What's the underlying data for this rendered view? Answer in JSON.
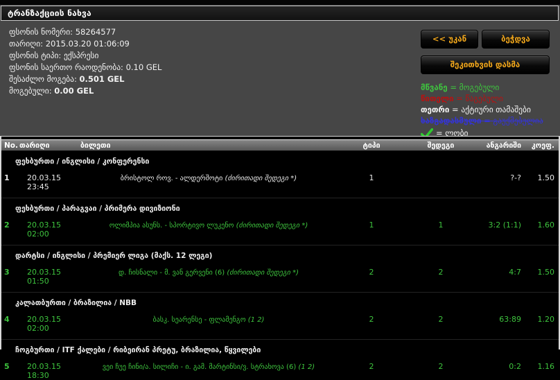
{
  "title": "ტრანზაქციის ნახვა",
  "info": {
    "bet_number": {
      "label": "ფსონის ნომერი:",
      "value": "58264577"
    },
    "date": {
      "label": "თარიღი:",
      "value": "2015.03.20 01:06:09"
    },
    "bet_type": {
      "label": "ფსონის ტიპი:",
      "value": "ექსპრესი"
    },
    "total_amount": {
      "label": "ფსონის საერთო რაოდენობა:",
      "value": "0.10 GEL"
    },
    "possible_win": {
      "label": "შესაძლო მოგება:",
      "value": "0.501 GEL"
    },
    "won": {
      "label": "მოგებული:",
      "value": "0.00 GEL"
    }
  },
  "buttons": {
    "back": "<< უკან",
    "print": "ბეჭდვა",
    "ask": "შეკითხვის დასმა"
  },
  "legend": {
    "won": {
      "key": "მწვანე",
      "rest": "= მოგებული"
    },
    "lost": {
      "key": "წითელი",
      "rest": "= წაგებული"
    },
    "active": {
      "key": "თეთრი",
      "rest": "= აქტიური თამაშები"
    },
    "cancelled": {
      "key": "ხაზგადასმული",
      "rest": "= გაუქმებულია"
    },
    "lobby": {
      "icon": "check-icon",
      "rest": "= ლობი"
    }
  },
  "colors": {
    "won_green": "#3ec43e",
    "lost_red": "#b91111",
    "active_white": "#eaeaea",
    "cancelled_blue": "#3434d6",
    "button_orange": "#f2a71b"
  },
  "table": {
    "headers": {
      "no": "No.",
      "date": "თარიღი",
      "ticket": "ბილეთი",
      "type": "ტიპი",
      "result": "შედეგი",
      "score": "ანგარიში",
      "coef": "კოეფ."
    },
    "groups": [
      {
        "league": "ფეხბურთი / ინგლისი / კონფერენსი",
        "row": {
          "no": "1",
          "date": "20.03.15 23:45",
          "match": "ბრისტოლ როვ. - ალდერშოტი",
          "note": "(ძირითადი შედეგი *)",
          "type": "1",
          "result": "",
          "score": "?-?",
          "coef": "1.50",
          "status": "active"
        }
      },
      {
        "league": "ფეხბურთი / პარაგვაი / პრიმერა დივიზიონი",
        "row": {
          "no": "2",
          "date": "20.03.15 02:00",
          "match": "ოლიმპია ასუნს. - სპორტივო ლუკენო",
          "note": "(ძირითადი შედეგი *)",
          "type": "1",
          "result": "1",
          "score": "3:2 (1:1)",
          "coef": "1.60",
          "status": "won"
        }
      },
      {
        "league": "დარტსი / ინგლისი / პრემიერ ლიგა (მაქს. 12 ლეგი)",
        "row": {
          "no": "3",
          "date": "20.03.15 01:50",
          "match": "დ. ჩისნალი - მ. ვან გერვენი (6)",
          "note": "(ძირითადი შედეგი *)",
          "type": "2",
          "result": "2",
          "score": "4:7",
          "coef": "1.50",
          "status": "won"
        }
      },
      {
        "league": "კალათბურთი / ბრაზილია / NBB",
        "row": {
          "no": "4",
          "date": "20.03.15 02:00",
          "match": "ბასკ. სეარენსე - ფლამენგო",
          "note": "(1 2)",
          "type": "2",
          "result": "2",
          "score": "63:89",
          "coef": "1.20",
          "status": "won"
        }
      },
      {
        "league": "ჩოგბურთი / ITF ქალები / რიბეირან პრეტუ, ბრაზილია, წყვილები",
        "row": {
          "no": "5",
          "date": "20.03.15 18:30",
          "match": "ვეი ჩუე ჩინი/ა. სილიჩი - ი. გამ. მარტინსი/ვ. სტრახოვა (6)",
          "note": "(1 2)",
          "type": "2",
          "result": "2",
          "score": "0:2",
          "coef": "1.16",
          "status": "won"
        }
      }
    ]
  }
}
